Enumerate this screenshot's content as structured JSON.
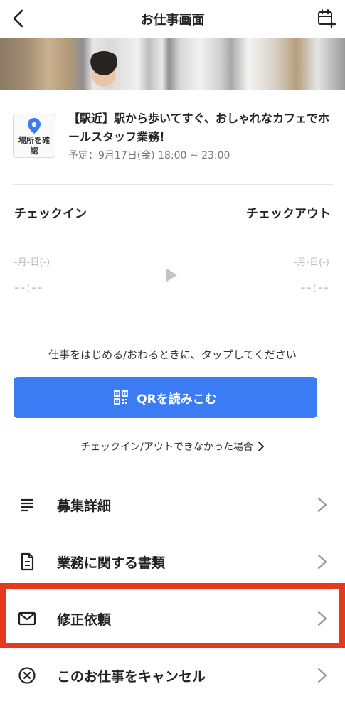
{
  "header": {
    "title": "お仕事画面"
  },
  "job": {
    "location_button_label": "場所を確認",
    "title": "【駅近】駅から歩いてすぐ、おしゃれなカフェでホールスタッフ業務！",
    "scheduled": "予定：9月17日(金) 18:00 ~ 23:00"
  },
  "checkin": {
    "in_label": "チェックイン",
    "out_label": "チェックアウト",
    "in_date": "-月-日(-)",
    "out_date": "-月-日(-)",
    "in_time": "--:--",
    "out_time": "--:--"
  },
  "action": {
    "instruction": "仕事をはじめる/おわるときに、タップしてください",
    "qr_label": "QRを読みこむ",
    "trouble_link": "チェックイン/アウトできなかった場合"
  },
  "menu": {
    "items": [
      {
        "label": "募集詳細",
        "icon": "list-lines-icon"
      },
      {
        "label": "業務に関する書類",
        "icon": "document-icon"
      },
      {
        "label": "修正依頼",
        "icon": "envelope-icon"
      },
      {
        "label": "このお仕事をキャンセル",
        "icon": "circle-x-icon"
      }
    ]
  },
  "colors": {
    "accent": "#3b7cf5",
    "highlight": "#e5391e"
  }
}
